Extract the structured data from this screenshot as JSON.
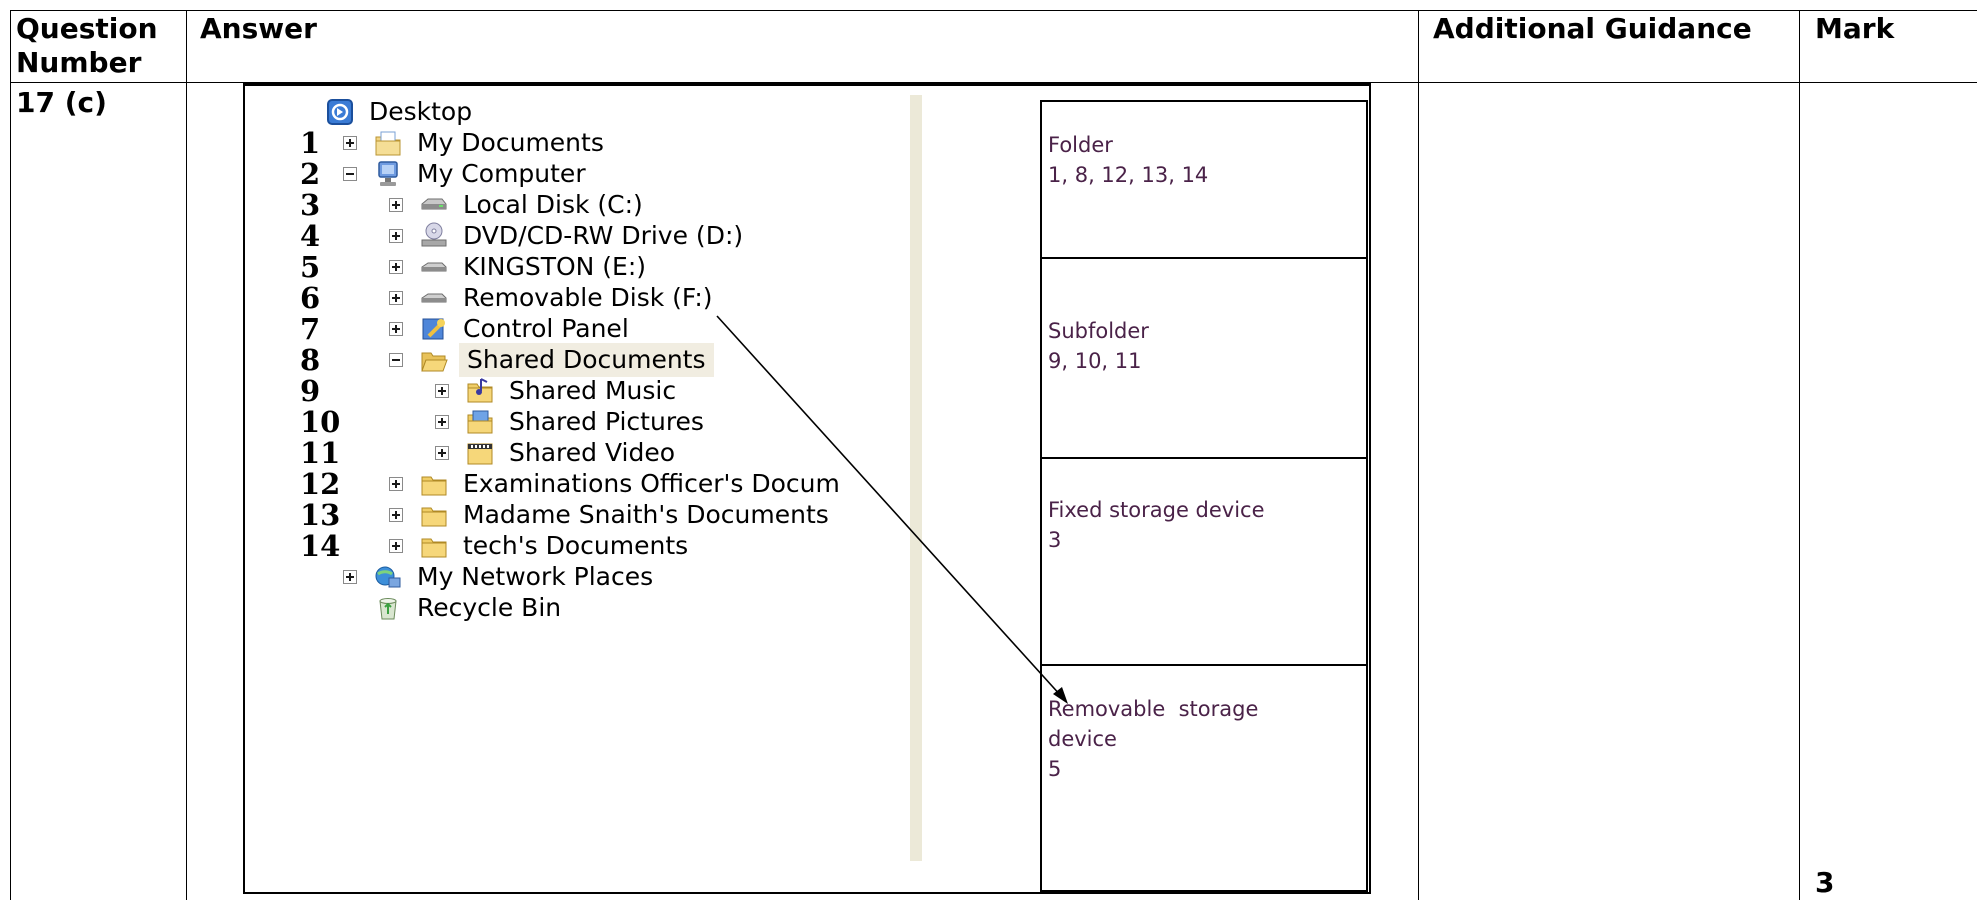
{
  "table": {
    "headers": {
      "question_number": "Question Number",
      "answer": "Answer",
      "additional_guidance": "Additional Guidance",
      "mark": "Mark"
    },
    "question_number": "17 (c)",
    "additional_guidance": "",
    "mark": "3"
  },
  "tree": {
    "items": [
      {
        "num": "",
        "label": "Desktop",
        "icon": "desktop-icon",
        "expander": "none"
      },
      {
        "num": "1",
        "label": "My Documents",
        "icon": "my-documents-icon",
        "expander": "plus"
      },
      {
        "num": "2",
        "label": "My Computer",
        "icon": "my-computer-icon",
        "expander": "minus"
      },
      {
        "num": "3",
        "label": "Local Disk (C:)",
        "icon": "hard-disk-icon",
        "expander": "plus"
      },
      {
        "num": "4",
        "label": "DVD/CD-RW Drive (D:)",
        "icon": "dvd-drive-icon",
        "expander": "plus"
      },
      {
        "num": "5",
        "label": "KINGSTON (E:)",
        "icon": "removable-drive-icon",
        "expander": "plus"
      },
      {
        "num": "6",
        "label": "Removable Disk (F:)",
        "icon": "removable-drive-icon",
        "expander": "plus"
      },
      {
        "num": "7",
        "label": "Control Panel",
        "icon": "control-panel-icon",
        "expander": "plus"
      },
      {
        "num": "8",
        "label": "Shared Documents",
        "icon": "open-folder-icon",
        "expander": "minus"
      },
      {
        "num": "9",
        "label": "Shared Music",
        "icon": "music-folder-icon",
        "expander": "plus"
      },
      {
        "num": "10",
        "label": "Shared Pictures",
        "icon": "pictures-folder-icon",
        "expander": "plus"
      },
      {
        "num": "11",
        "label": "Shared Video",
        "icon": "video-folder-icon",
        "expander": "plus"
      },
      {
        "num": "12",
        "label": "Examinations Officer's Docum",
        "icon": "folder-icon",
        "expander": "plus"
      },
      {
        "num": "13",
        "label": "Madame Snaith's Documents",
        "icon": "folder-icon",
        "expander": "plus"
      },
      {
        "num": "14",
        "label": "tech's Documents",
        "icon": "folder-icon",
        "expander": "plus"
      },
      {
        "num": "",
        "label": "My Network Places",
        "icon": "network-places-icon",
        "expander": "plus"
      },
      {
        "num": "",
        "label": "Recycle Bin",
        "icon": "recycle-bin-icon",
        "expander": "none"
      }
    ]
  },
  "categories": [
    {
      "title": "Folder",
      "values": "1, 8, 12, 13, 14"
    },
    {
      "title": "Subfolder",
      "values": "9, 10, 11"
    },
    {
      "title": "Fixed storage device",
      "values": "3"
    },
    {
      "title": "Removable  storage device",
      "values": "5"
    }
  ],
  "colors": {
    "category_text": "#4a2248",
    "selection_background": "#f1ede1",
    "tree_divider": "#ece9d8"
  }
}
